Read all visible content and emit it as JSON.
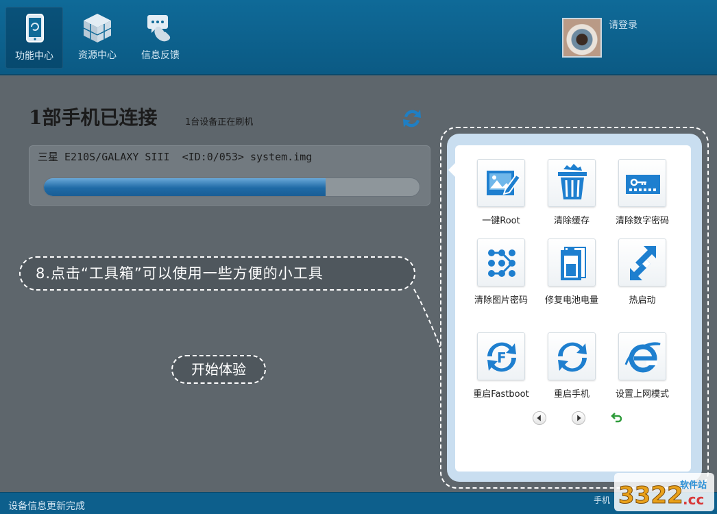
{
  "nav": {
    "items": [
      {
        "label": "功能中心",
        "icon": "phone-refresh-icon",
        "active": true
      },
      {
        "label": "资源中心",
        "icon": "cubes-icon",
        "active": false
      },
      {
        "label": "信息反馈",
        "icon": "chat-phone-icon",
        "active": false
      }
    ]
  },
  "user": {
    "login_label": "请登录",
    "avatar_icon": "eye-avatar"
  },
  "main": {
    "connected_title": "1部手机已连接",
    "flashing_note": "1台设备正在刷机",
    "device_line": "三星 E210S/GALAXY SIII  <ID:0/053> system.img",
    "progress_fraction": 0.75
  },
  "callout": {
    "tip_text": "8.点击“工具箱”可以使用一些方便的小工具",
    "start_label": "开始体验"
  },
  "toolbox": {
    "tools": [
      {
        "label": "一键Root",
        "icon": "root-edit-icon"
      },
      {
        "label": "清除缓存",
        "icon": "trash-icon"
      },
      {
        "label": "清除数字密码",
        "icon": "numeric-password-icon"
      },
      {
        "label": "清除图片密码",
        "icon": "pattern-lock-icon"
      },
      {
        "label": "修复电池电量",
        "icon": "battery-icon"
      },
      {
        "label": "热启动",
        "icon": "hot-restart-icon"
      },
      {
        "label": "重启Fastboot",
        "icon": "fastboot-refresh-icon"
      },
      {
        "label": "重启手机",
        "icon": "refresh-icon"
      },
      {
        "label": "设置上网模式",
        "icon": "ie-browser-icon"
      }
    ],
    "nav_icons": [
      "prev-page-icon",
      "next-page-icon",
      "back-icon"
    ]
  },
  "status": {
    "message": "设备信息更新完成",
    "right_text": "手机"
  },
  "watermark": {
    "brand": "3322.cc",
    "tag": "软件站"
  },
  "colors": {
    "accent_blue": "#1a73b8",
    "topbar": "#0f6a98",
    "panel_bg": "#5e666c"
  }
}
